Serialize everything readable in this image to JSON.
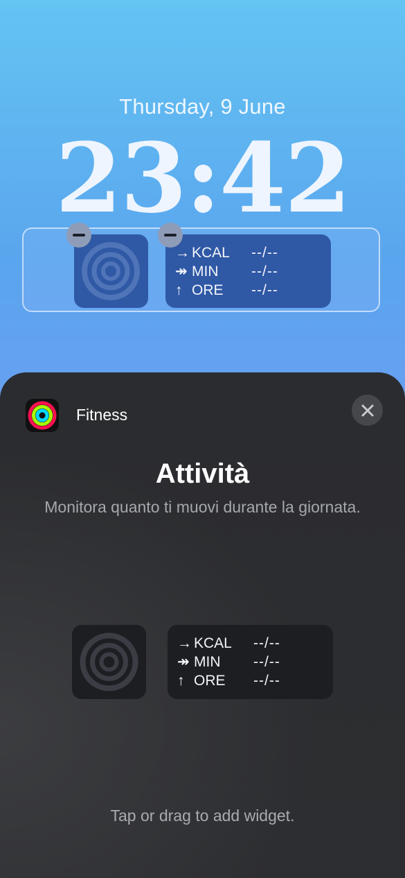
{
  "lockscreen": {
    "date": "Thursday, 9 June",
    "time": "23:42",
    "widgets": {
      "stats": [
        {
          "icon": "arrow-right-icon",
          "glyph": "→",
          "label": "KCAL",
          "value": "--/--"
        },
        {
          "icon": "double-arrow-right-icon",
          "glyph": "↠",
          "label": "MIN",
          "value": "--/--"
        },
        {
          "icon": "arrow-up-icon",
          "glyph": "↑",
          "label": "ORE",
          "value": "--/--"
        }
      ]
    }
  },
  "sheet": {
    "app_name": "Fitness",
    "title": "Attività",
    "subtitle": "Monitora quanto ti muovi durante la giornata.",
    "preview_stats": [
      {
        "icon": "arrow-right-icon",
        "glyph": "→",
        "label": "KCAL",
        "value": "--/--"
      },
      {
        "icon": "double-arrow-right-icon",
        "glyph": "↠",
        "label": "MIN",
        "value": "--/--"
      },
      {
        "icon": "arrow-up-icon",
        "glyph": "↑",
        "label": "ORE",
        "value": "--/--"
      }
    ],
    "hint": "Tap or drag to add widget."
  },
  "colors": {
    "ring_red": "#fa114f",
    "ring_green": "#a6ff00",
    "ring_blue": "#00d8fe",
    "widget_blue": "#2f58a5",
    "sheet_bg": "#2c2d30"
  }
}
